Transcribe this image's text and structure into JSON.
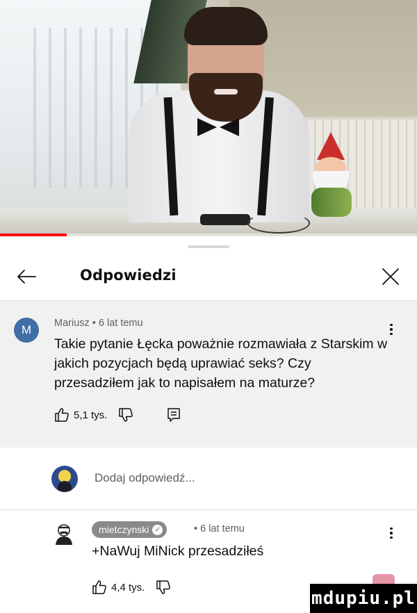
{
  "sheet": {
    "title": "Odpowiedzi"
  },
  "comment": {
    "avatar_letter": "M",
    "author": "Mariusz",
    "time": "6 lat temu",
    "text": "Takie pytanie Łęcka poważnie rozmawiała z Starskim w jakich pozycjach będą uprawiać seks? Czy przesadziłem jak to napisałem na maturze?",
    "likes": "5,1 tys."
  },
  "add_reply": {
    "placeholder": "Dodaj odpowiedź..."
  },
  "reply": {
    "channel": "mietczynski",
    "time": "6 lat temu",
    "text": "+NaWuj MiNick przesadziłeś",
    "likes": "4,4 tys."
  },
  "watermark": {
    "text": "mdupiu.pl"
  },
  "colors": {
    "progress": "#ff0000",
    "avatar_m": "#3f6fa6",
    "comment_bg": "#f1f1f1",
    "channel_pill": "#8a8a8a"
  },
  "video": {
    "progress_fraction": 0.16
  }
}
